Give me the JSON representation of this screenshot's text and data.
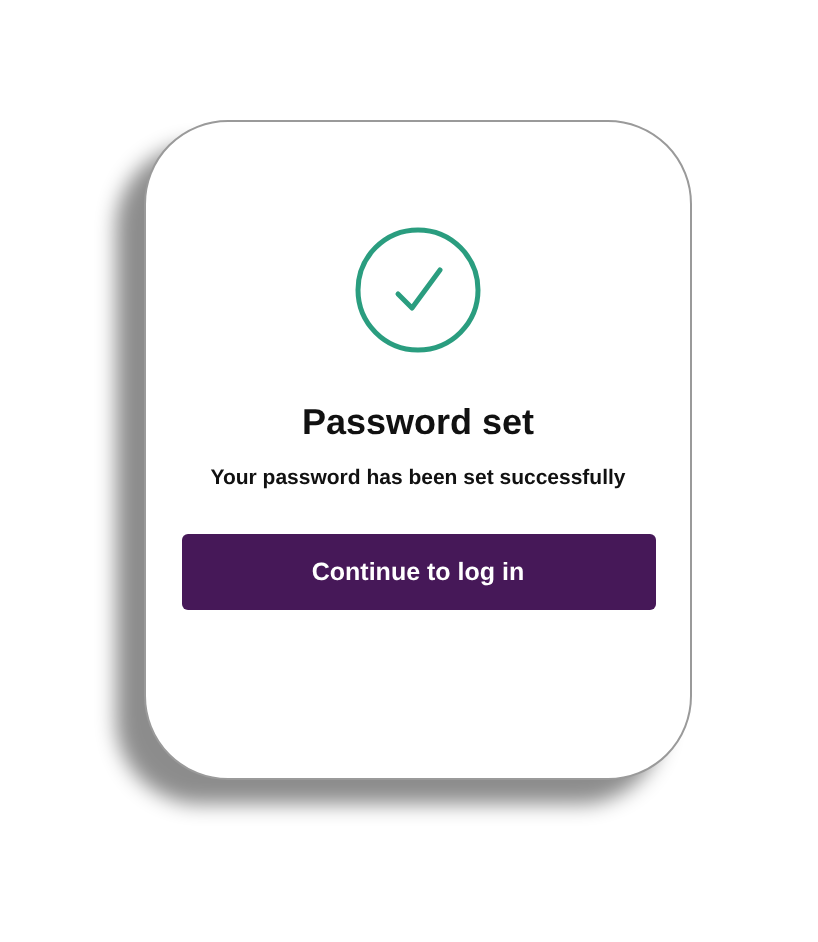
{
  "dialog": {
    "title": "Password set",
    "message": "Your password has been set successfully",
    "button": "Continue to log in"
  }
}
